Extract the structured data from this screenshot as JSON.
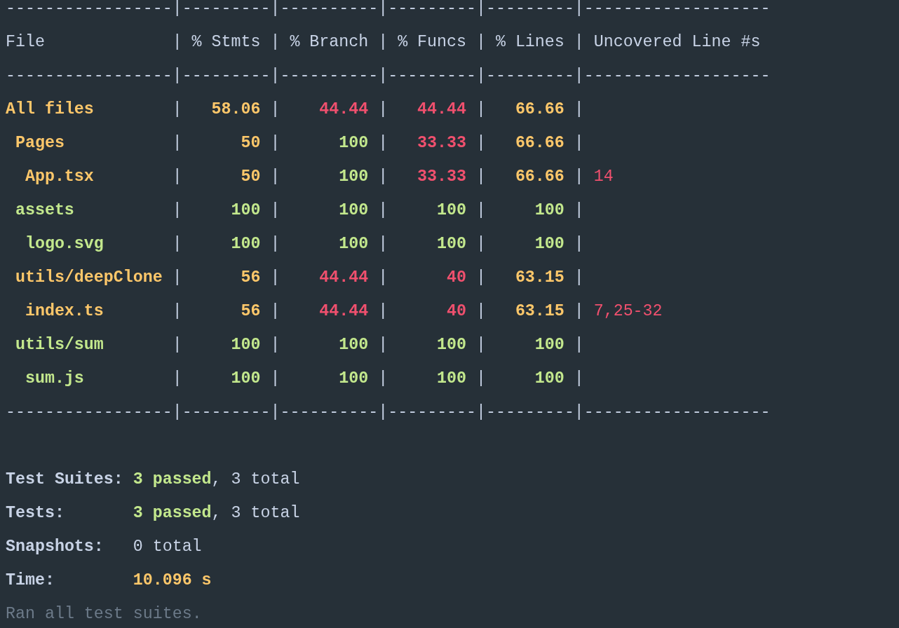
{
  "coverage_table": {
    "rule": "-----------------|---------|----------|---------|---------|-------------------",
    "separator": "|",
    "columns": [
      "File",
      "% Stmts",
      "% Branch",
      "% Funcs",
      "% Lines",
      "Uncovered Line #s"
    ],
    "rows": [
      {
        "file": "All files",
        "color": "#fdc76a",
        "stmts": {
          "value": "58.06",
          "color": "#fdc76a"
        },
        "branch": {
          "value": "44.44",
          "color": "#f0506e"
        },
        "funcs": {
          "value": "44.44",
          "color": "#f0506e"
        },
        "lines": {
          "value": "66.66",
          "color": "#fdc76a"
        },
        "children": [
          {
            "file": "Pages",
            "color": "#fdc76a",
            "stmts": {
              "value": "50",
              "color": "#fdc76a"
            },
            "branch": {
              "value": "100",
              "color": "#c3e88d"
            },
            "funcs": {
              "value": "33.33",
              "color": "#f0506e"
            },
            "lines": {
              "value": "66.66",
              "color": "#fdc76a"
            },
            "children": [
              {
                "file": "App.tsx",
                "color": "#fdc76a",
                "stmts": {
                  "value": "50",
                  "color": "#fdc76a"
                },
                "branch": {
                  "value": "100",
                  "color": "#c3e88d"
                },
                "funcs": {
                  "value": "33.33",
                  "color": "#f0506e"
                },
                "lines": {
                  "value": "66.66",
                  "color": "#fdc76a"
                },
                "uncovered": "14"
              }
            ]
          },
          {
            "file": "assets",
            "color": "#c3e88d",
            "stmts": {
              "value": "100",
              "color": "#c3e88d"
            },
            "branch": {
              "value": "100",
              "color": "#c3e88d"
            },
            "funcs": {
              "value": "100",
              "color": "#c3e88d"
            },
            "lines": {
              "value": "100",
              "color": "#c3e88d"
            },
            "children": [
              {
                "file": "logo.svg",
                "color": "#c3e88d",
                "stmts": {
                  "value": "100",
                  "color": "#c3e88d"
                },
                "branch": {
                  "value": "100",
                  "color": "#c3e88d"
                },
                "funcs": {
                  "value": "100",
                  "color": "#c3e88d"
                },
                "lines": {
                  "value": "100",
                  "color": "#c3e88d"
                }
              }
            ]
          },
          {
            "file": "utils/deepClone",
            "color": "#fdc76a",
            "stmts": {
              "value": "56",
              "color": "#fdc76a"
            },
            "branch": {
              "value": "44.44",
              "color": "#f0506e"
            },
            "funcs": {
              "value": "40",
              "color": "#f0506e"
            },
            "lines": {
              "value": "63.15",
              "color": "#fdc76a"
            },
            "children": [
              {
                "file": "index.ts",
                "color": "#fdc76a",
                "stmts": {
                  "value": "56",
                  "color": "#fdc76a"
                },
                "branch": {
                  "value": "44.44",
                  "color": "#f0506e"
                },
                "funcs": {
                  "value": "40",
                  "color": "#f0506e"
                },
                "lines": {
                  "value": "63.15",
                  "color": "#fdc76a"
                },
                "uncovered": "7,25-32"
              }
            ]
          },
          {
            "file": "utils/sum",
            "color": "#c3e88d",
            "stmts": {
              "value": "100",
              "color": "#c3e88d"
            },
            "branch": {
              "value": "100",
              "color": "#c3e88d"
            },
            "funcs": {
              "value": "100",
              "color": "#c3e88d"
            },
            "lines": {
              "value": "100",
              "color": "#c3e88d"
            },
            "children": [
              {
                "file": "sum.js",
                "color": "#c3e88d",
                "stmts": {
                  "value": "100",
                  "color": "#c3e88d"
                },
                "branch": {
                  "value": "100",
                  "color": "#c3e88d"
                },
                "funcs": {
                  "value": "100",
                  "color": "#c3e88d"
                },
                "lines": {
                  "value": "100",
                  "color": "#c3e88d"
                }
              }
            ]
          }
        ]
      }
    ]
  },
  "summary": [
    {
      "label": "Test Suites:",
      "parts": [
        {
          "text": "3 passed",
          "kind": "success"
        },
        {
          "text": ", 3 total",
          "kind": "plain"
        }
      ]
    },
    {
      "label": "Tests:",
      "parts": [
        {
          "text": "3 passed",
          "kind": "success"
        },
        {
          "text": ", 3 total",
          "kind": "plain"
        }
      ]
    },
    {
      "label": "Snapshots:",
      "parts": [
        {
          "text": "0 total",
          "kind": "plain"
        }
      ]
    },
    {
      "label": "Time:",
      "parts": [
        {
          "text": "10.096 s",
          "kind": "warning"
        }
      ]
    }
  ],
  "footer": "Ran all test suites."
}
